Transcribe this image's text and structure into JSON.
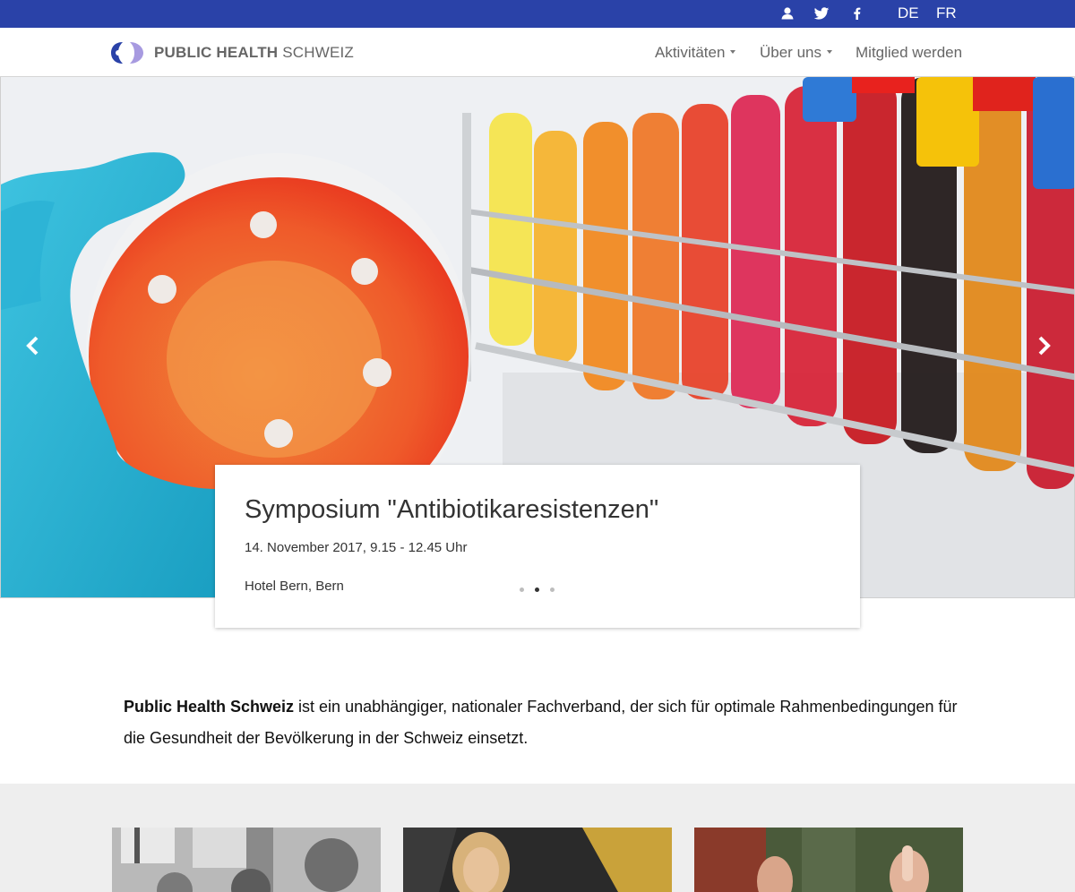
{
  "topbar": {
    "icons": [
      "user-icon",
      "twitter-icon",
      "facebook-icon"
    ],
    "languages": [
      "DE",
      "FR"
    ],
    "color": "#2a42a8"
  },
  "brand": {
    "name_bold": "PUBLIC HEALTH",
    "name_light": "SCHWEIZ"
  },
  "nav": {
    "items": [
      {
        "label": "Aktivitäten",
        "dropdown": true
      },
      {
        "label": "Über uns",
        "dropdown": true
      },
      {
        "label": "Mitglied werden",
        "dropdown": false
      }
    ]
  },
  "hero": {
    "prev_icon": "chevron-left-icon",
    "next_icon": "chevron-right-icon",
    "caption": {
      "title": "Symposium \"Antibiotikaresistenzen\"",
      "date": "14. November 2017, 9.15 - 12.45 Uhr",
      "place": "Hotel Bern, Bern"
    },
    "slide_count": 3,
    "active_slide": 2
  },
  "intro": {
    "bold": "Public Health Schweiz",
    "text": " ist ein unabhängiger, nationaler Fachverband, der sich für optimale Rahmenbedingungen für die Gesundheit der Bevölkerung in der Schweiz einsetzt."
  }
}
